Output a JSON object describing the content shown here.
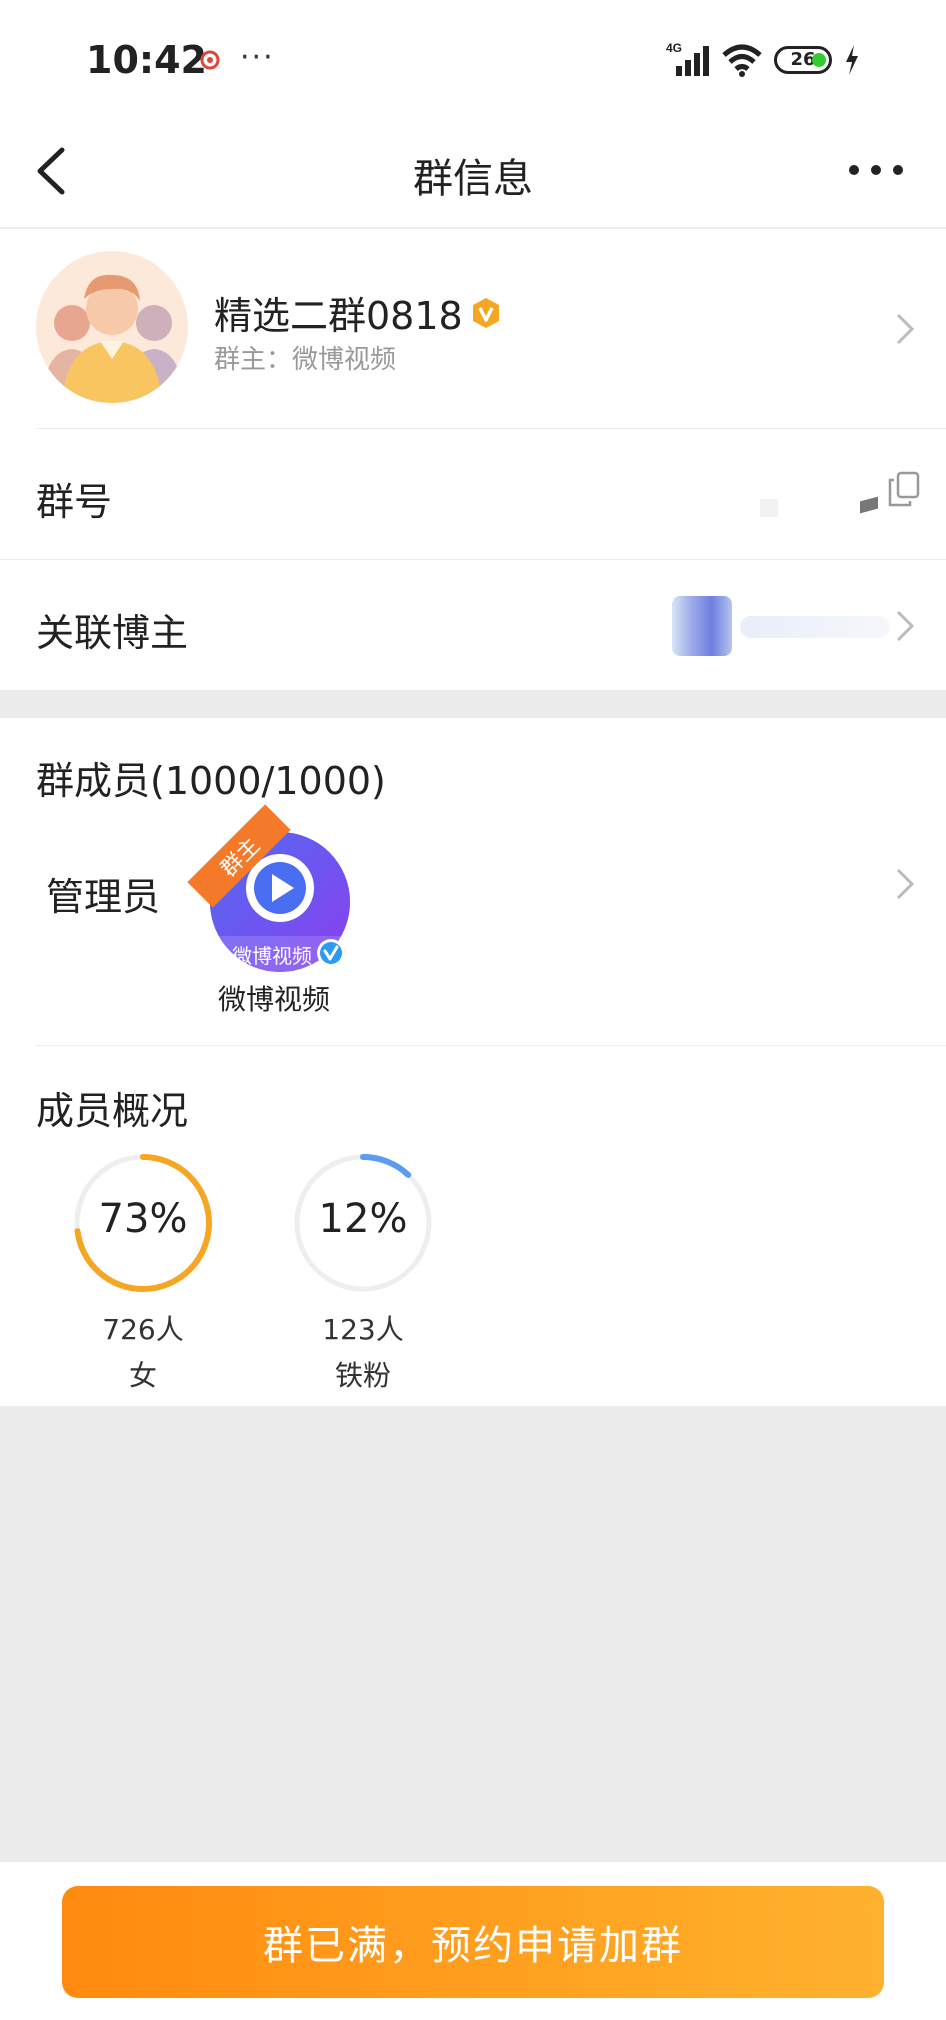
{
  "status_bar": {
    "time": "10:42",
    "dots": "···",
    "network": "4G",
    "battery": "26"
  },
  "nav": {
    "title": "群信息"
  },
  "group": {
    "name": "精选二群0818",
    "owner": "群主：微博视频"
  },
  "rows": {
    "group_number_label": "群号",
    "linked_blogger_label": "关联博主"
  },
  "members": {
    "title": "群成员(1000/1000)",
    "admin_label": "管理员",
    "owner_tag": "群主",
    "admin_avatar_text": "微博视频",
    "admin_name": "微博视频"
  },
  "overview": {
    "title": "成员概况",
    "stats": [
      {
        "percent": "73%",
        "value": 0.73,
        "count": "726人",
        "label": "女",
        "color": "#f5a623"
      },
      {
        "percent": "12%",
        "value": 0.12,
        "count": "123人",
        "label": "铁粉",
        "color": "#5b9bf0"
      }
    ]
  },
  "join_button": {
    "label": "群已满，预约申请加群"
  }
}
